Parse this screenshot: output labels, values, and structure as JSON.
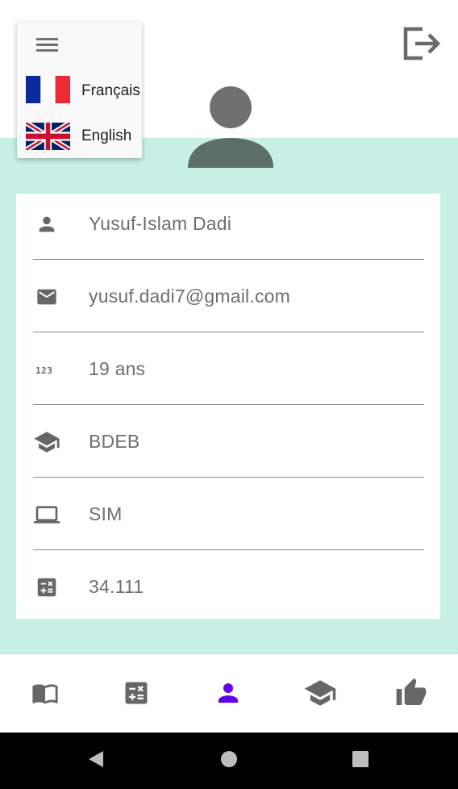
{
  "language_menu": {
    "items": [
      {
        "label": "Français",
        "flag": "france-flag"
      },
      {
        "label": "English",
        "flag": "uk-flag"
      }
    ]
  },
  "profile": {
    "rows": [
      {
        "icon": "person-icon",
        "value": "Yusuf-Islam Dadi"
      },
      {
        "icon": "email-icon",
        "value": "yusuf.dadi7@gmail.com"
      },
      {
        "icon": "numbers-icon",
        "value": "19 ans"
      },
      {
        "icon": "school-icon",
        "value": "BDEB"
      },
      {
        "icon": "computer-icon",
        "value": "SIM"
      },
      {
        "icon": "calculator-icon",
        "value": "34.111"
      }
    ]
  },
  "bottom_nav": {
    "items": [
      "book-icon",
      "calculator-icon",
      "person-icon",
      "school-icon",
      "thumbs-up-icon"
    ],
    "active_index": 2
  },
  "colors": {
    "accent": "#6200ee",
    "mint_background": "#c6f0e4",
    "icon_gray": "#666666",
    "avatar_head": "#707070",
    "avatar_body": "#5b6e68"
  }
}
